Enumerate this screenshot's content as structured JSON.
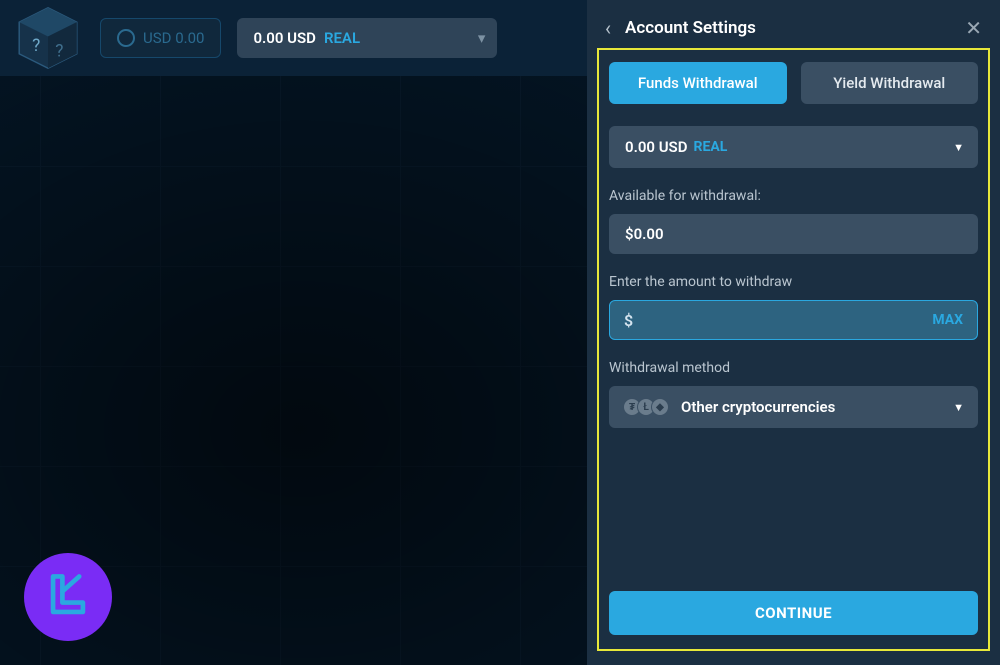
{
  "topbar": {
    "usd_pill": "USD 0.00",
    "balance_amount": "0.00 USD",
    "balance_tag": "REAL"
  },
  "panel": {
    "title": "Account Settings",
    "tabs": {
      "funds": "Funds Withdrawal",
      "yield": "Yield Withdrawal"
    },
    "account_select": {
      "amount": "0.00 USD",
      "tag": "REAL"
    },
    "available": {
      "label": "Available for withdrawal:",
      "value": "$0.00"
    },
    "amount": {
      "label": "Enter the amount to withdraw",
      "symbol": "$",
      "value": "",
      "max_label": "MAX"
    },
    "method": {
      "label": "Withdrawal method",
      "selected": "Other cryptocurrencies"
    },
    "continue_label": "CONTINUE"
  }
}
